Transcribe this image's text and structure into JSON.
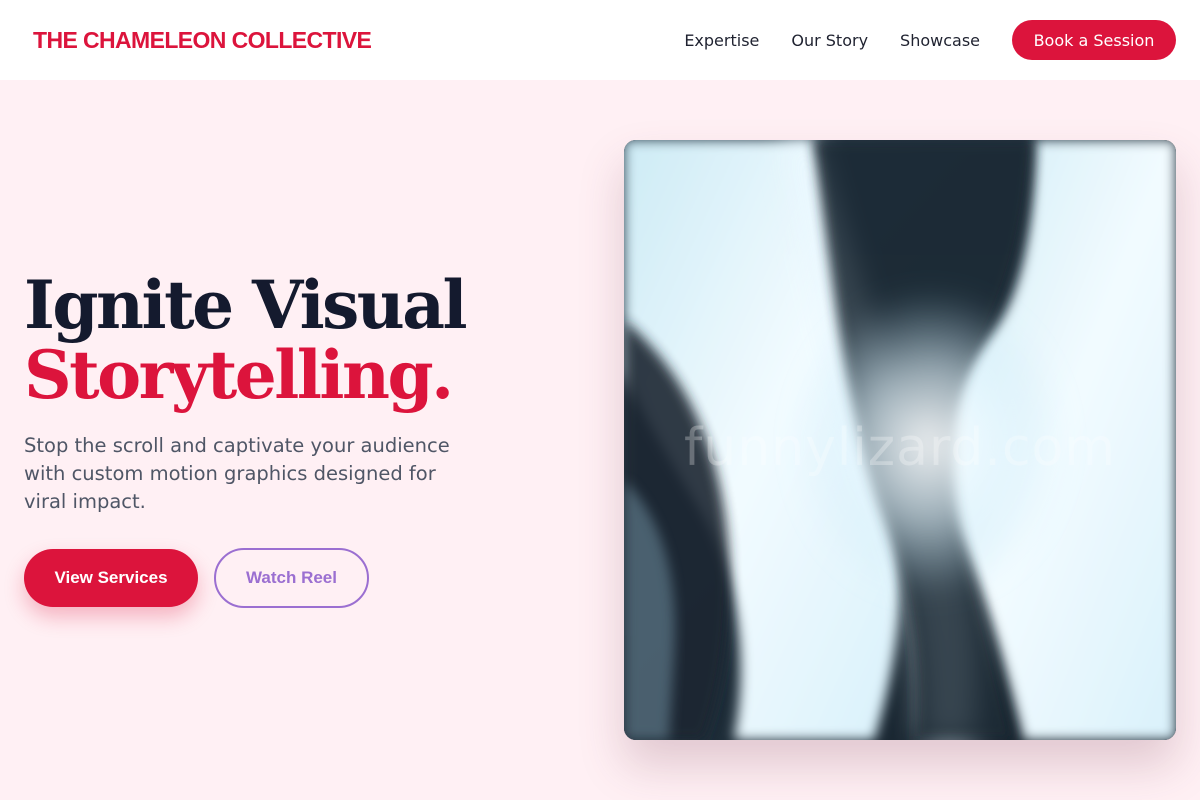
{
  "header": {
    "logo": "THE CHAMELEON COLLECTIVE",
    "nav": [
      "Expertise",
      "Our Story",
      "Showcase"
    ],
    "cta": "Book a Session"
  },
  "hero": {
    "title_line1": "Ignite Visual",
    "title_line2": "Storytelling.",
    "subtitle": "Stop the scroll and captivate your audience with custom motion graphics designed for viral impact.",
    "primary_button": "View Services",
    "secondary_button": "Watch Reel"
  },
  "media": {
    "watermark": "funnylizard.com"
  },
  "colors": {
    "brand": "#dc143c",
    "accent_purple": "#9b6fd1",
    "page_background": "#fff0f4",
    "heading_dark": "#141a2e"
  }
}
